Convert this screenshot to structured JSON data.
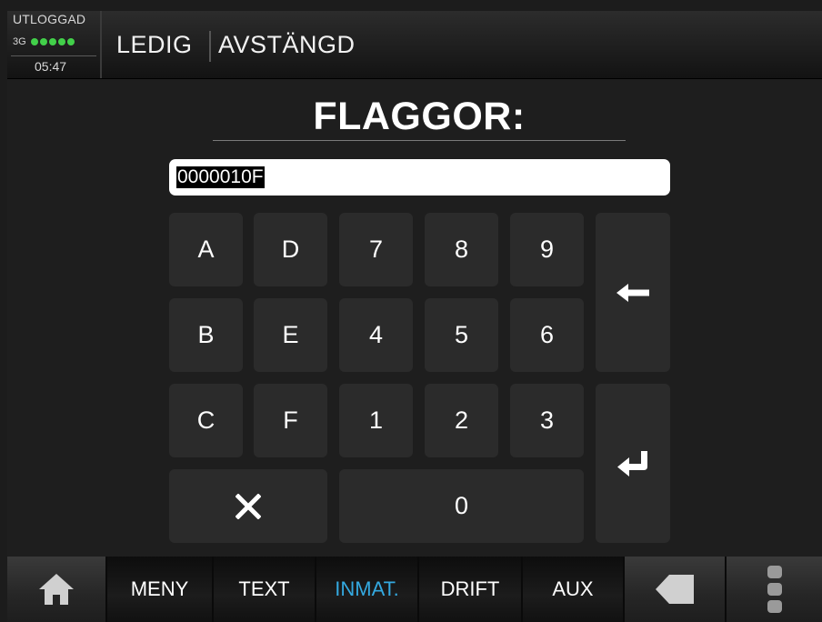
{
  "header": {
    "login_status": "UTLOGGAD",
    "network_type": "3G",
    "signal_bars": 5,
    "time": "05:47",
    "state_1": "LEDIG",
    "state_2": "AVSTÄNGD"
  },
  "title": "FLAGGOR:",
  "input": {
    "value": "0000010F"
  },
  "keypad": {
    "keys": [
      "A",
      "D",
      "7",
      "8",
      "9",
      "B",
      "E",
      "4",
      "5",
      "6",
      "C",
      "F",
      "1",
      "2",
      "3",
      "0"
    ],
    "backspace_icon": "backspace-arrow-icon",
    "clear_icon": "x-icon",
    "enter_icon": "enter-return-icon"
  },
  "bottom_bar": {
    "home_icon": "home-icon",
    "items": [
      "MENY",
      "TEXT",
      "INMAT.",
      "DRIFT",
      "AUX"
    ],
    "active_item": "INMAT.",
    "back_icon": "back-icon",
    "more_icon": "more-icon"
  },
  "colors": {
    "background": "#1e1e1e",
    "key_background": "#2b2b2b",
    "signal_green": "#42d04a",
    "active_tab": "#34a9e0"
  }
}
